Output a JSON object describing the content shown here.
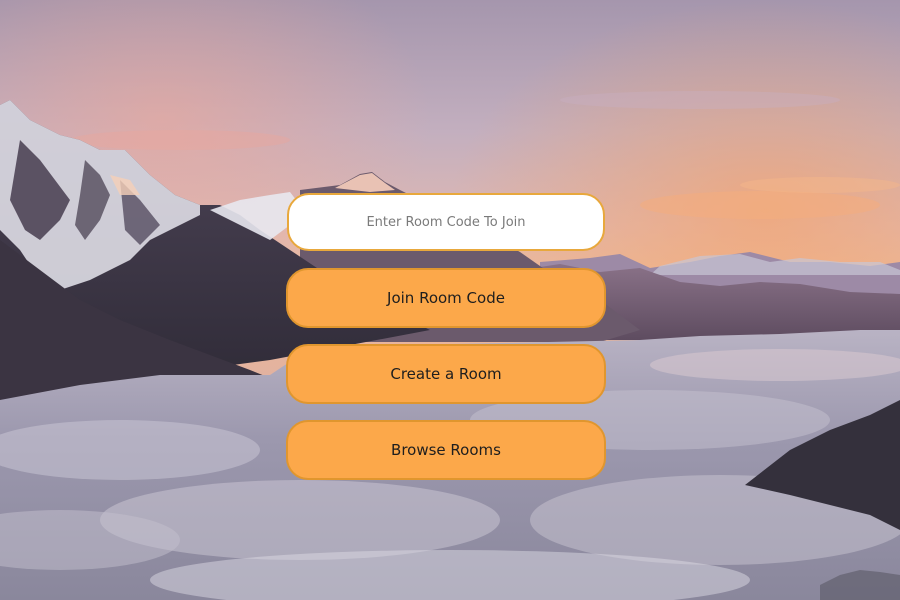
{
  "join_input": {
    "placeholder": "Enter Room Code To Join",
    "value": ""
  },
  "buttons": {
    "join_label": "Join Room Code",
    "create_label": "Create a Room",
    "browse_label": "Browse Rooms"
  },
  "colors": {
    "button_fill": "#fca84a",
    "button_border": "#e0962e",
    "input_border": "#e8a83c"
  }
}
